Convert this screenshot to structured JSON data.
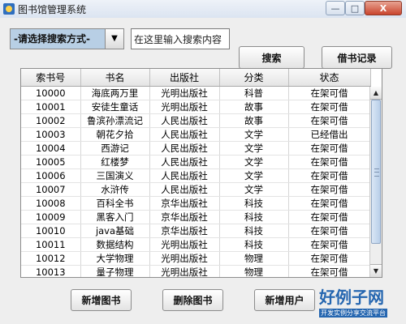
{
  "window": {
    "title": "图书馆管理系统",
    "min_label": "—",
    "max_label": "□",
    "close_label": "X"
  },
  "search": {
    "mode_selected": "-请选择搜索方式-",
    "input_value": "在这里输入搜索内容",
    "search_button": "搜索",
    "borrow_records_button": "借书记录"
  },
  "table": {
    "columns": [
      "索书号",
      "书名",
      "出版社",
      "分类",
      "状态"
    ],
    "rows": [
      [
        "10000",
        "海底两万里",
        "光明出版社",
        "科普",
        "在架可借"
      ],
      [
        "10001",
        "安徒生童话",
        "光明出版社",
        "故事",
        "在架可借"
      ],
      [
        "10002",
        "鲁滨孙漂流记",
        "人民出版社",
        "故事",
        "在架可借"
      ],
      [
        "10003",
        "朝花夕拾",
        "人民出版社",
        "文学",
        "已经借出"
      ],
      [
        "10004",
        "西游记",
        "人民出版社",
        "文学",
        "在架可借"
      ],
      [
        "10005",
        "红楼梦",
        "人民出版社",
        "文学",
        "在架可借"
      ],
      [
        "10006",
        "三国演义",
        "人民出版社",
        "文学",
        "在架可借"
      ],
      [
        "10007",
        "水浒传",
        "人民出版社",
        "文学",
        "在架可借"
      ],
      [
        "10008",
        "百科全书",
        "京华出版社",
        "科技",
        "在架可借"
      ],
      [
        "10009",
        "黑客入门",
        "京华出版社",
        "科技",
        "在架可借"
      ],
      [
        "10010",
        "java基础",
        "京华出版社",
        "科技",
        "在架可借"
      ],
      [
        "10011",
        "数据结构",
        "光明出版社",
        "科技",
        "在架可借"
      ],
      [
        "10012",
        "大学物理",
        "光明出版社",
        "物理",
        "在架可借"
      ],
      [
        "10013",
        "量子物理",
        "光明出版社",
        "物理",
        "在架可借"
      ]
    ]
  },
  "actions": {
    "add_book": "新增图书",
    "delete_book": "删除图书",
    "add_user": "新增用户"
  },
  "watermark": {
    "main": "好例子网",
    "sub": "开发实例分享交流平台"
  }
}
